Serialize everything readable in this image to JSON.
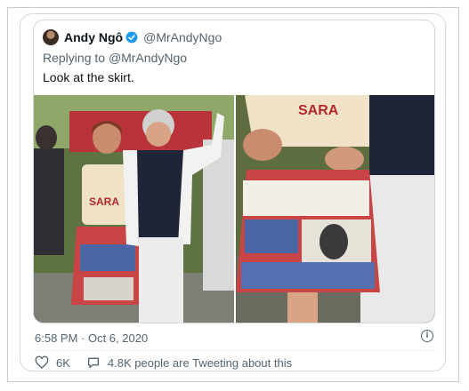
{
  "tweet": {
    "author_name": "Andy Ngô",
    "author_handle": "@MrAndyNgo",
    "reply_prefix": "Replying to ",
    "reply_to": "@MrAndyNgo",
    "text": "Look at the skirt.",
    "timestamp": "6:58 PM · Oct 6, 2020",
    "likes": "6K",
    "replies_text": "4.8K people are Tweeting about this",
    "verified": true
  },
  "media": {
    "left_shirt_text": "SARA",
    "right_shirt_text": "SARA"
  },
  "colors": {
    "accent": "#1d9bf0",
    "secondary_text": "#536471",
    "border": "#cfd9de"
  },
  "icons": {
    "like": "heart-outline-icon",
    "reply": "speech-bubble-icon",
    "info": "info-circle-icon",
    "verified": "verified-badge-icon"
  }
}
